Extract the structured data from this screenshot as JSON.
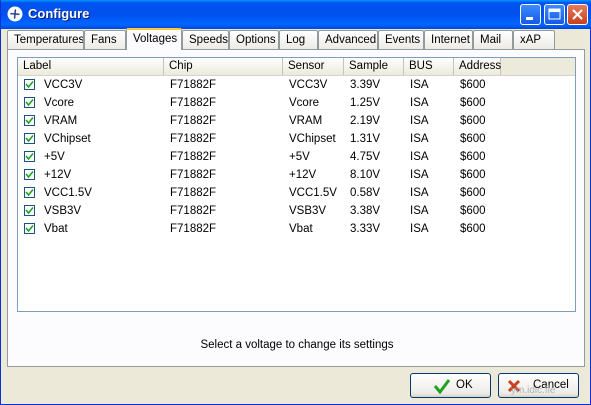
{
  "window": {
    "title": "Configure"
  },
  "tabs": [
    {
      "label": "Temperatures"
    },
    {
      "label": "Fans"
    },
    {
      "label": "Voltages",
      "active": true
    },
    {
      "label": "Speeds"
    },
    {
      "label": "Options"
    },
    {
      "label": "Log"
    },
    {
      "label": "Advanced"
    },
    {
      "label": "Events"
    },
    {
      "label": "Internet"
    },
    {
      "label": "Mail"
    },
    {
      "label": "xAP"
    }
  ],
  "table": {
    "columns": [
      "Label",
      "Chip",
      "Sensor",
      "Sample",
      "BUS",
      "Address"
    ],
    "rows": [
      {
        "checked": true,
        "label": "VCC3V",
        "chip": "F71882F",
        "sensor": "VCC3V",
        "sample": "3.39V",
        "bus": "ISA",
        "address": "$600"
      },
      {
        "checked": true,
        "label": "Vcore",
        "chip": "F71882F",
        "sensor": "Vcore",
        "sample": "1.25V",
        "bus": "ISA",
        "address": "$600"
      },
      {
        "checked": true,
        "label": "VRAM",
        "chip": "F71882F",
        "sensor": "VRAM",
        "sample": "2.19V",
        "bus": "ISA",
        "address": "$600"
      },
      {
        "checked": true,
        "label": "VChipset",
        "chip": "F71882F",
        "sensor": "VChipset",
        "sample": "1.31V",
        "bus": "ISA",
        "address": "$600"
      },
      {
        "checked": true,
        "label": "+5V",
        "chip": "F71882F",
        "sensor": "+5V",
        "sample": "4.75V",
        "bus": "ISA",
        "address": "$600"
      },
      {
        "checked": true,
        "label": "+12V",
        "chip": "F71882F",
        "sensor": "+12V",
        "sample": "8.10V",
        "bus": "ISA",
        "address": "$600"
      },
      {
        "checked": true,
        "label": "VCC1.5V",
        "chip": "F71882F",
        "sensor": "VCC1.5V",
        "sample": "0.58V",
        "bus": "ISA",
        "address": "$600"
      },
      {
        "checked": true,
        "label": "VSB3V",
        "chip": "F71882F",
        "sensor": "VSB3V",
        "sample": "3.38V",
        "bus": "ISA",
        "address": "$600"
      },
      {
        "checked": true,
        "label": "Vbat",
        "chip": "F71882F",
        "sensor": "Vbat",
        "sample": "3.33V",
        "bus": "ISA",
        "address": "$600"
      }
    ]
  },
  "hint": "Select a voltage to change its settings",
  "buttons": {
    "ok": "OK",
    "cancel": "Cancel"
  },
  "watermark": "ym.idic.fle",
  "icons": {
    "app": "fan-icon",
    "ok": "checkmark-icon",
    "cancel": "cross-icon"
  },
  "colors": {
    "titlebar": "#0053ee",
    "tab_highlight": "#ffc83c",
    "ok_check": "#21a121",
    "cancel_x": "#c9401e"
  }
}
